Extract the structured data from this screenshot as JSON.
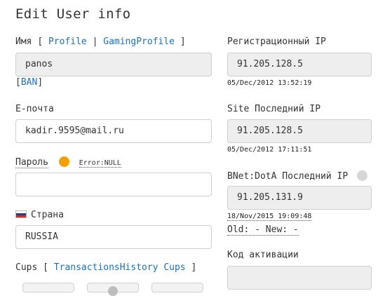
{
  "page_title": "Edit User info",
  "name": {
    "label": "Имя",
    "bracket_open": "[",
    "separator": "|",
    "bracket_close": "]",
    "profile_link": "Profile",
    "gaming_profile_link": "GamingProfile",
    "value": "panos",
    "ban_open": "[",
    "ban_link": "BAN",
    "ban_close": "]"
  },
  "email": {
    "label": "E-почта",
    "value": "kadir.9595@mail.ru"
  },
  "password": {
    "label": "Пароль",
    "status": "Error:NULL",
    "status_color": "#f5a000",
    "value": ""
  },
  "country": {
    "label": "Страна",
    "value": "RUSSIA",
    "flag_colors": [
      "#ffffff",
      "#1c3f94",
      "#d52b1e"
    ]
  },
  "cups": {
    "label": "Cups",
    "bracket_open": "[",
    "link": "TransactionsHistory Cups",
    "bracket_close": "]"
  },
  "registration_ip": {
    "label": "Регистрационный IP",
    "value": "91.205.128.5",
    "timestamp": "05/Dec/2012 13:52:19"
  },
  "site_last_ip": {
    "label": "Site Последний IP",
    "value": "91.205.128.5",
    "timestamp": "05/Dec/2012 17:11:51"
  },
  "bnet_last_ip": {
    "label": "BNet:DotA Последний IP",
    "indicator_color": "#d6d6d6",
    "value": "91.205.131.9",
    "timestamp": "18/Nov/2015 19:09:48",
    "old_new": "Old: - New: -"
  },
  "activation_code": {
    "label": "Код активации",
    "value": ""
  }
}
